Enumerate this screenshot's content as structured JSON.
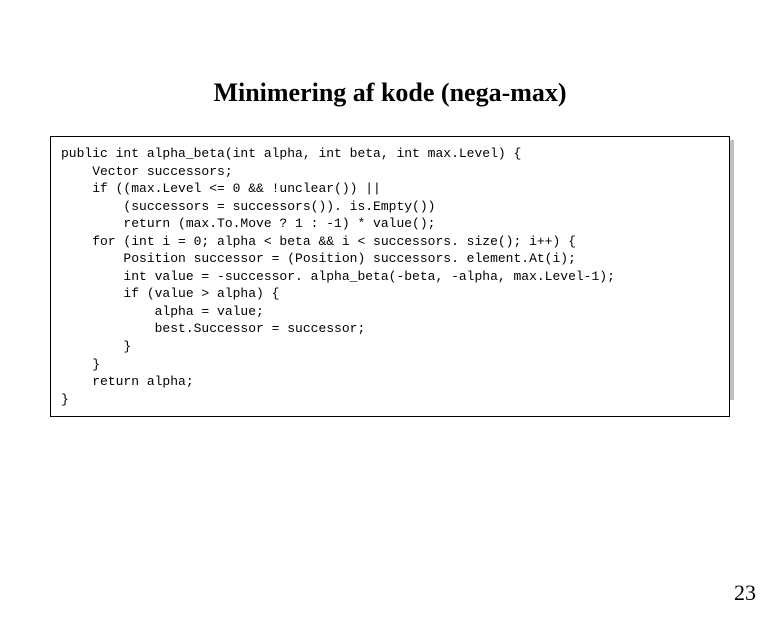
{
  "title": "Minimering af kode (nega-max)",
  "code": "public int alpha_beta(int alpha, int beta, int max.Level) {\n    Vector successors;\n    if ((max.Level <= 0 && !unclear()) ||\n        (successors = successors()). is.Empty())\n        return (max.To.Move ? 1 : -1) * value();\n    for (int i = 0; alpha < beta && i < successors. size(); i++) {\n        Position successor = (Position) successors. element.At(i);\n        int value = -successor. alpha_beta(-beta, -alpha, max.Level-1);\n        if (value > alpha) {\n            alpha = value;\n            best.Successor = successor;\n        }\n    }\n    return alpha;\n}",
  "page_number": "23"
}
